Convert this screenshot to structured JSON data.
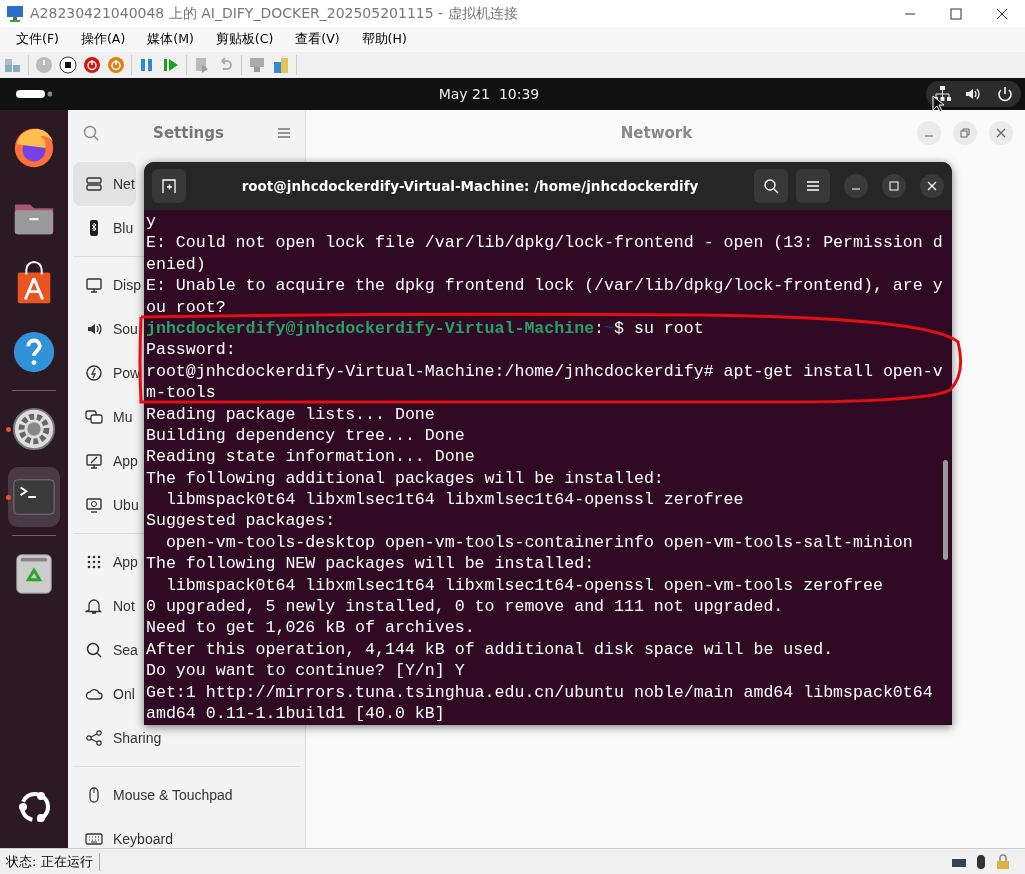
{
  "host_window": {
    "title": "A28230421040048 上的 AI_DIFY_DOCKER_202505201115 - 虚拟机连接",
    "menu": [
      "文件(F)",
      "操作(A)",
      "媒体(M)",
      "剪贴板(C)",
      "查看(V)",
      "帮助(H)"
    ],
    "status": "状态: 正在运行"
  },
  "topbar": {
    "date": "May 21",
    "time": "10:39"
  },
  "dock": [
    {
      "running": false,
      "selected": false
    },
    {
      "running": false,
      "selected": false
    },
    {
      "running": false,
      "selected": false
    },
    {
      "running": false,
      "selected": false
    },
    {
      "running": true,
      "selected": false
    },
    {
      "running": true,
      "selected": true
    },
    {
      "running": false,
      "selected": false
    }
  ],
  "settings": {
    "title": "Settings",
    "page_title": "Network",
    "sidebar": [
      {
        "items": [
          {
            "label": "Net",
            "selected": true
          },
          {
            "label": "Blu",
            "selected": false
          }
        ]
      },
      {
        "items": [
          {
            "label": "Disp",
            "selected": false
          },
          {
            "label": "Sou",
            "selected": false
          },
          {
            "label": "Pow",
            "selected": false
          },
          {
            "label": "Mu",
            "selected": false
          },
          {
            "label": "App",
            "selected": false
          },
          {
            "label": "Ubu",
            "selected": false
          }
        ]
      },
      {
        "items": [
          {
            "label": "App",
            "selected": false
          },
          {
            "label": "Not",
            "selected": false
          },
          {
            "label": "Sea",
            "selected": false
          },
          {
            "label": "Onl",
            "selected": false
          },
          {
            "label": "Sharing",
            "selected": false
          }
        ]
      },
      {
        "items": [
          {
            "label": "Mouse & Touchpad",
            "selected": false
          },
          {
            "label": "Keyboard",
            "selected": false
          }
        ]
      }
    ]
  },
  "terminal": {
    "title": "root@jnhcdockerdify-Virtual-Machine: /home/jnhcdockerdify",
    "lines": [
      {
        "text": "y"
      },
      {
        "text": "E: Could not open lock file /var/lib/dpkg/lock-frontend - open (13: Permission d"
      },
      {
        "text": "enied)"
      },
      {
        "text": "E: Unable to acquire the dpkg frontend lock (/var/lib/dpkg/lock-frontend), are y"
      },
      {
        "text": "ou root?"
      },
      {
        "kind": "prompt",
        "user": "jnhcdockerdify@jnhcdockerdify-Virtual-Machine",
        "sep": ":",
        "path": "~",
        "command": "$ su root"
      },
      {
        "text": "Password:"
      },
      {
        "text": "root@jnhcdockerdify-Virtual-Machine:/home/jnhcdockerdify# apt-get install open-v"
      },
      {
        "text": "m-tools"
      },
      {
        "text": "Reading package lists... Done"
      },
      {
        "text": "Building dependency tree... Done"
      },
      {
        "text": "Reading state information... Done"
      },
      {
        "text": "The following additional packages will be installed:"
      },
      {
        "text": "  libmspack0t64 libxmlsec1t64 libxmlsec1t64-openssl zerofree"
      },
      {
        "text": "Suggested packages:"
      },
      {
        "text": "  open-vm-tools-desktop open-vm-tools-containerinfo open-vm-tools-salt-minion"
      },
      {
        "text": "The following NEW packages will be installed:"
      },
      {
        "text": "  libmspack0t64 libxmlsec1t64 libxmlsec1t64-openssl open-vm-tools zerofree"
      },
      {
        "text": "0 upgraded, 5 newly installed, 0 to remove and 111 not upgraded."
      },
      {
        "text": "Need to get 1,026 kB of archives."
      },
      {
        "text": "After this operation, 4,144 kB of additional disk space will be used."
      },
      {
        "text": "Do you want to continue? [Y/n] Y"
      },
      {
        "text": "Get:1 http://mirrors.tuna.tsinghua.edu.cn/ubuntu noble/main amd64 libmspack0t64"
      },
      {
        "text": "amd64 0.11-1.1build1 [40.0 kB]"
      }
    ]
  }
}
